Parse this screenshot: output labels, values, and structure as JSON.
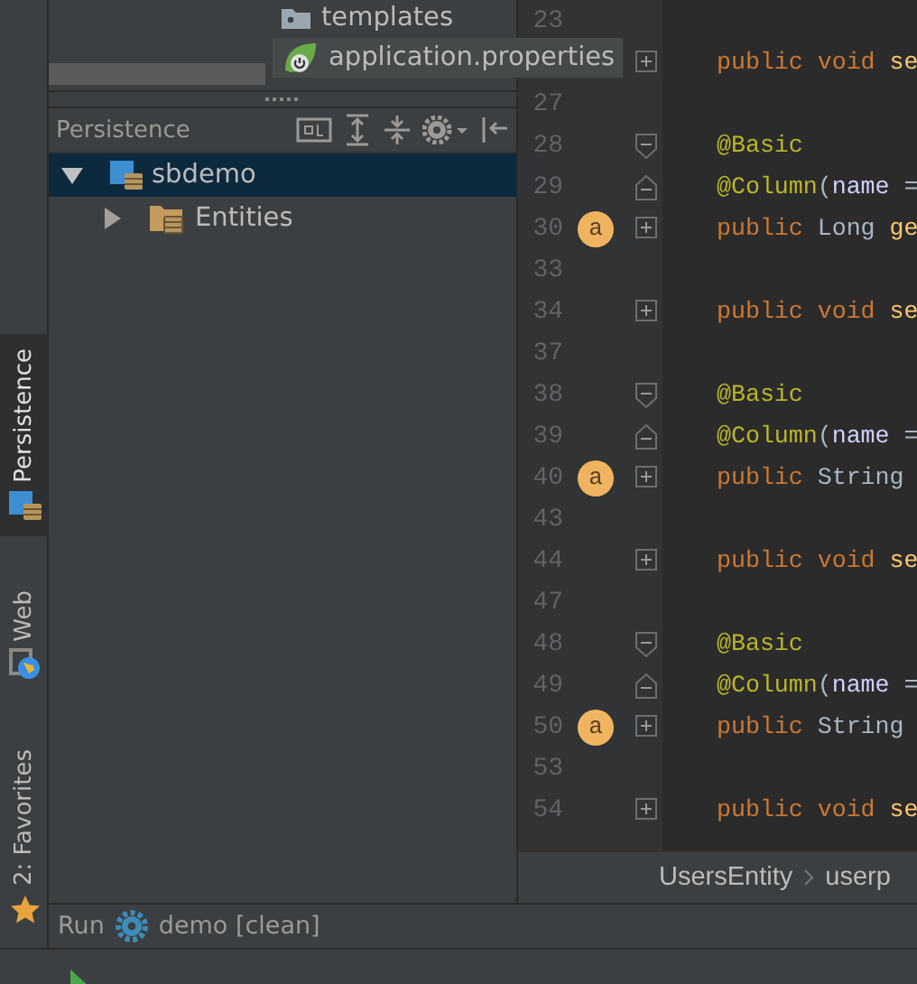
{
  "project_tree": [
    {
      "label": "templates",
      "kind": "folder"
    },
    {
      "label": "application.properties",
      "kind": "spring"
    }
  ],
  "persistence": {
    "title": "Persistence",
    "tree": [
      {
        "label": "sbdemo",
        "kind": "module",
        "expanded": true,
        "selected": true,
        "children": [
          {
            "label": "Entities",
            "kind": "folder",
            "expanded": false,
            "selected": false
          }
        ]
      }
    ]
  },
  "side_tabs": [
    {
      "label": "Persistence",
      "kind": "persistence",
      "selected": true
    },
    {
      "label": "Web",
      "kind": "web",
      "selected": false
    },
    {
      "label": "2: Favorites",
      "kind": "favorites",
      "selected": false
    }
  ],
  "editor": {
    "lines": [
      {
        "number": "23"
      },
      {
        "fold": {
          "collapsed": true
        },
        "code": [
          {
            "kind": "keyword",
            "text": "public void "
          },
          {
            "kind": "method",
            "text": "se"
          }
        ]
      },
      {
        "number": "27"
      },
      {
        "number": "28",
        "fold": {
          "collapsed": false,
          "end": false
        },
        "code": [
          {
            "kind": "annotation",
            "text": "@Basic"
          }
        ]
      },
      {
        "number": "29",
        "fold": {
          "collapsed": false,
          "end": true
        },
        "code": [
          {
            "kind": "annotation",
            "text": "@Column"
          },
          {
            "kind": "plain",
            "text": "("
          },
          {
            "kind": "param",
            "text": "name"
          },
          {
            "kind": "plain",
            "text": " ="
          }
        ]
      },
      {
        "number": "30",
        "badge": "a",
        "fold": {
          "collapsed": true
        },
        "code": [
          {
            "kind": "keyword",
            "text": "public "
          },
          {
            "kind": "plain",
            "text": "Long "
          },
          {
            "kind": "method",
            "text": "ge"
          }
        ]
      },
      {
        "number": "33"
      },
      {
        "number": "34",
        "fold": {
          "collapsed": true
        },
        "code": [
          {
            "kind": "keyword",
            "text": "public void "
          },
          {
            "kind": "method",
            "text": "se"
          }
        ]
      },
      {
        "number": "37"
      },
      {
        "number": "38",
        "fold": {
          "collapsed": false,
          "end": false
        },
        "code": [
          {
            "kind": "annotation",
            "text": "@Basic"
          }
        ]
      },
      {
        "number": "39",
        "fold": {
          "collapsed": false,
          "end": true
        },
        "code": [
          {
            "kind": "annotation",
            "text": "@Column"
          },
          {
            "kind": "plain",
            "text": "("
          },
          {
            "kind": "param",
            "text": "name"
          },
          {
            "kind": "plain",
            "text": " ="
          }
        ]
      },
      {
        "number": "40",
        "badge": "a",
        "fold": {
          "collapsed": true
        },
        "code": [
          {
            "kind": "keyword",
            "text": "public "
          },
          {
            "kind": "plain",
            "text": "String"
          }
        ]
      },
      {
        "number": "43"
      },
      {
        "number": "44",
        "fold": {
          "collapsed": true
        },
        "code": [
          {
            "kind": "keyword",
            "text": "public void "
          },
          {
            "kind": "method",
            "text": "se"
          }
        ]
      },
      {
        "number": "47"
      },
      {
        "number": "48",
        "fold": {
          "collapsed": false,
          "end": false
        },
        "code": [
          {
            "kind": "annotation",
            "text": "@Basic"
          }
        ]
      },
      {
        "number": "49",
        "fold": {
          "collapsed": false,
          "end": true
        },
        "code": [
          {
            "kind": "annotation",
            "text": "@Column"
          },
          {
            "kind": "plain",
            "text": "("
          },
          {
            "kind": "param",
            "text": "name"
          },
          {
            "kind": "plain",
            "text": " ="
          }
        ]
      },
      {
        "number": "50",
        "badge": "a",
        "fold": {
          "collapsed": true
        },
        "code": [
          {
            "kind": "keyword",
            "text": "public "
          },
          {
            "kind": "plain",
            "text": "String"
          }
        ]
      },
      {
        "number": "53"
      },
      {
        "number": "54",
        "fold": {
          "collapsed": true
        },
        "code": [
          {
            "kind": "keyword",
            "text": "public void "
          },
          {
            "kind": "method",
            "text": "se"
          }
        ]
      }
    ],
    "breadcrumb": [
      "UsersEntity",
      "userp"
    ]
  },
  "run_bar": {
    "title": "Run",
    "config": "demo [clean]"
  }
}
